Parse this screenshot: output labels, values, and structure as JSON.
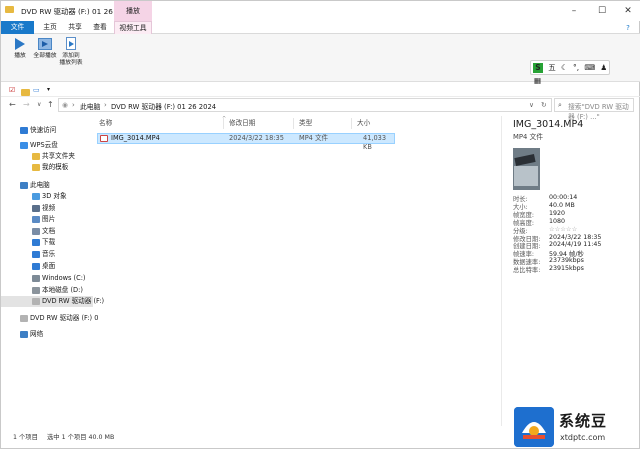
{
  "window": {
    "title": "DVD RW 驱动器 (F:) 01 26 2024",
    "context_tab_group": "播放",
    "controls": {
      "minimize": "–",
      "maximize": "☐",
      "close": "✕",
      "help": "?"
    }
  },
  "ribbon": {
    "tabs": [
      "文件",
      "主页",
      "共享",
      "查看",
      "视频工具"
    ],
    "buttons": [
      {
        "label": "播放"
      },
      {
        "label": "全部播放"
      },
      {
        "label": "添加到",
        "label2": "播放列表"
      }
    ],
    "ime_bar": {
      "s": "S",
      "mode": "五"
    }
  },
  "quick_access": {
    "dropdown": "▾"
  },
  "address": {
    "path": [
      "此电脑",
      "DVD RW 驱动器 (F:) 01 26 2024"
    ],
    "search_placeholder": "搜索\"DVD RW 驱动器 (F:) ...\""
  },
  "nav": {
    "items": [
      {
        "label": "快速访问",
        "icon": "star-icon",
        "color": "#2f7bd4"
      },
      {
        "label": "WPS云盘",
        "icon": "cloud-icon",
        "color": "#3a8ee6"
      },
      {
        "label": "共享文件夹",
        "icon": "folder-icon",
        "color": "#e7b941"
      },
      {
        "label": "我的模板",
        "icon": "folder-icon",
        "color": "#e7b941"
      },
      {
        "label": "此电脑",
        "icon": "computer-icon",
        "color": "#3d7fc4"
      },
      {
        "label": "3D 对象",
        "icon": "cube-icon",
        "color": "#4a9be0"
      },
      {
        "label": "视频",
        "icon": "video-icon",
        "color": "#5a6f8a"
      },
      {
        "label": "图片",
        "icon": "picture-icon",
        "color": "#5a8ac4"
      },
      {
        "label": "文档",
        "icon": "document-icon",
        "color": "#7a8da6"
      },
      {
        "label": "下载",
        "icon": "download-icon",
        "color": "#2f7bd4"
      },
      {
        "label": "音乐",
        "icon": "music-icon",
        "color": "#2f7bd4"
      },
      {
        "label": "桌面",
        "icon": "desktop-icon",
        "color": "#2f7bd4"
      },
      {
        "label": "Windows (C:)",
        "icon": "drive-icon",
        "color": "#7d8a96"
      },
      {
        "label": "本地磁盘 (D:)",
        "icon": "drive-icon",
        "color": "#8b949c"
      },
      {
        "label": "DVD RW 驱动器 (F:)",
        "icon": "dvd-icon",
        "color": "#b3b3b3",
        "selected": true
      },
      {
        "label": "DVD RW 驱动器 (F:) 0",
        "icon": "dvd-icon",
        "color": "#b3b3b3"
      },
      {
        "label": "网络",
        "icon": "network-icon",
        "color": "#3d7fc4"
      }
    ]
  },
  "filelist": {
    "columns": [
      "名称",
      "修改日期",
      "类型",
      "大小"
    ],
    "rows": [
      {
        "name": "IMG_3014.MP4",
        "modified": "2024/3/22 18:35",
        "type": "MP4 文件",
        "size": "41,033 KB"
      }
    ]
  },
  "details": {
    "name": "IMG_3014.MP4",
    "type": "MP4 文件",
    "props": [
      {
        "label": "时长:",
        "value": "00:00:14"
      },
      {
        "label": "大小:",
        "value": "40.0 MB"
      },
      {
        "label": "帧宽度:",
        "value": "1920"
      },
      {
        "label": "帧高度:",
        "value": "1080"
      },
      {
        "label": "分级:",
        "value": "☆☆☆☆☆"
      },
      {
        "label": "修改日期:",
        "value": "2024/3/22 18:35"
      },
      {
        "label": "创建日期:",
        "value": "2024/4/19 11:45"
      },
      {
        "label": "帧速率:",
        "value": "59.94 帧/秒"
      },
      {
        "label": "数据速率:",
        "value": "23739kbps"
      },
      {
        "label": "总比特率:",
        "value": "23915kbps"
      }
    ]
  },
  "status": {
    "count": "1 个项目",
    "selected": "选中 1 个项目 40.0 MB"
  },
  "watermark": {
    "title": "系统豆",
    "url": "xtdptc.com"
  }
}
